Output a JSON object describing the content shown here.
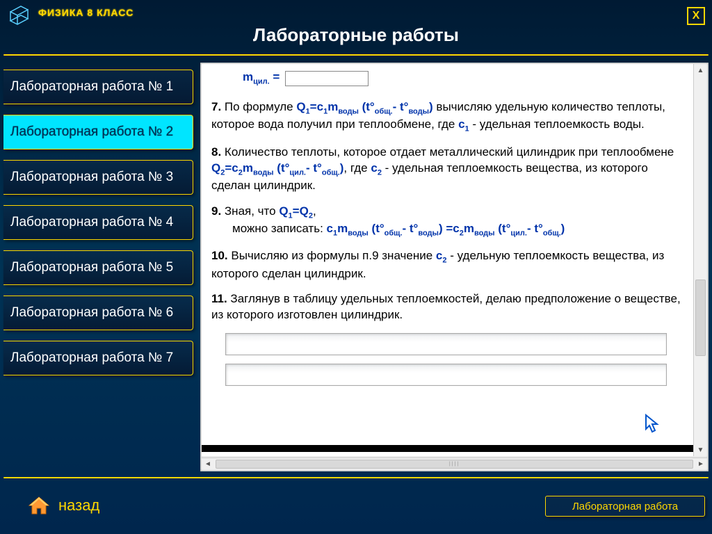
{
  "header": {
    "logo_text": "ФИЗИКА 8 КЛАСС",
    "title": "Лабораторные работы",
    "close": "X"
  },
  "sidebar": {
    "items": [
      {
        "label": "Лабораторная работа № 1",
        "active": false
      },
      {
        "label": "Лабораторная работа № 2",
        "active": true
      },
      {
        "label": "Лабораторная работа № 3",
        "active": false
      },
      {
        "label": "Лабораторная работа № 4",
        "active": false
      },
      {
        "label": "Лабораторная работа № 5",
        "active": false
      },
      {
        "label": "Лабораторная работа № 6",
        "active": false
      },
      {
        "label": "Лабораторная работа № 7",
        "active": false
      }
    ]
  },
  "doc": {
    "m_label_prefix": "m",
    "m_label_sub": "цил.",
    "m_label_eq": " = ",
    "p7_num": "7.",
    "p7_a": " По формуле  ",
    "p7_formula": "Q<sub>1</sub>=c<sub>1</sub>m<sub>воды</sub> (t°<sub>общ.</sub>- t°<sub>воды</sub>)",
    "p7_b": " вычисляю удельную количество теплоты, которое вода получил при теплообмене, где ",
    "p7_c1": "c<sub>1</sub>",
    "p7_c": "  - удельная теплоемкость воды.",
    "p8_num": "8.",
    "p8_a": " Количество теплоты, которое отдает металлический цилиндрик при теплообмене ",
    "p8_formula": "Q<sub>2</sub>=c<sub>2</sub>m<sub>воды</sub> (t°<sub>цил.</sub>- t°<sub>общ.</sub>)",
    "p8_b": ",  где ",
    "p8_c2": "c<sub>2</sub>",
    "p8_c": "  - удельная теплоемкость вещества, из которого сделан цилиндрик.",
    "p9_num": "9.",
    "p9_a": " Зная, что ",
    "p9_eq": "Q<sub>1</sub>=Q<sub>2</sub>",
    "p9_b": ",",
    "p9_c_prefix": "можно записать: ",
    "p9_formula": "c<sub>1</sub>m<sub>воды</sub> (t°<sub>общ.</sub>- t°<sub>воды</sub>) =c<sub>2</sub>m<sub>воды</sub> (t°<sub>цил.</sub>- t°<sub>общ.</sub>)",
    "p10_num": "10.",
    "p10_a": " Вычисляю из  формулы п.9 значение ",
    "p10_c2": "c<sub>2</sub>",
    "p10_b": " - удельную теплоемкость вещества, из которого сделан цилиндрик.",
    "p11_num": "11.",
    "p11_a": " Заглянув в таблицу удельных теплоемкостей, делаю предположение о веществе, из которого изготовлен цилиндрик."
  },
  "footer": {
    "back": "назад",
    "label": "Лабораторная работа"
  }
}
